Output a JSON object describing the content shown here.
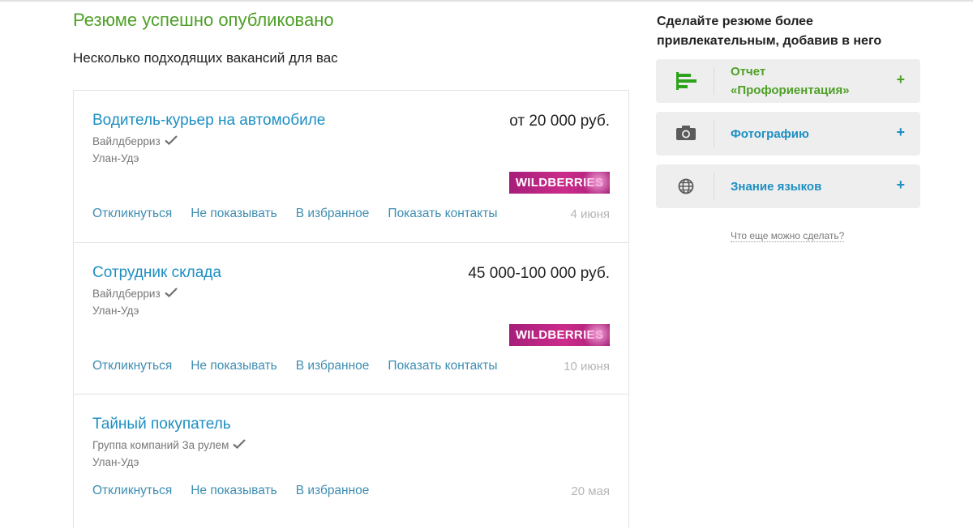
{
  "page": {
    "success_title": "Резюме успешно опубликовано",
    "subtitle": "Несколько подходящих вакансий для вас"
  },
  "vacancies": [
    {
      "title": "Водитель-курьер на автомобиле",
      "salary": "от 20 000 руб.",
      "company": "Вайлдберриз",
      "city": "Улан-Удэ",
      "logo": "WILDBERRIES",
      "actions": [
        "Откликнуться",
        "Не показывать",
        "В избранное",
        "Показать контакты"
      ],
      "date": "4 июня"
    },
    {
      "title": "Сотрудник склада",
      "salary": "45 000-100 000 руб.",
      "company": "Вайлдберриз",
      "city": "Улан-Удэ",
      "logo": "WILDBERRIES",
      "actions": [
        "Откликнуться",
        "Не показывать",
        "В избранное",
        "Показать контакты"
      ],
      "date": "10 июня"
    },
    {
      "title": "Тайный покупатель",
      "salary": "",
      "company": "Группа компаний За рулем",
      "city": "Улан-Удэ",
      "logo": "",
      "actions": [
        "Откликнуться",
        "Не показывать",
        "В избранное"
      ],
      "date": "20 мая"
    }
  ],
  "sidebar": {
    "title": "Сделайте резюме более привлекательным, добавив в него",
    "items": [
      {
        "label_line1": "Отчет",
        "label_line2": "«Профориентация»",
        "icon": "bar-chart-icon",
        "plus": "+",
        "color": "#4fa028"
      },
      {
        "label": "Фотографию",
        "icon": "camera-icon",
        "plus": "+",
        "color": "#1d8fc2"
      },
      {
        "label": "Знание языков",
        "icon": "globe-icon",
        "plus": "+",
        "color": "#1d8fc2"
      }
    ],
    "more_link": "Что еще можно сделать?"
  },
  "colors": {
    "accent_green": "#4fa028",
    "link_blue": "#1d8fc2",
    "action_blue": "#3d8db2",
    "logo_magenta": "#cb2c8a"
  }
}
